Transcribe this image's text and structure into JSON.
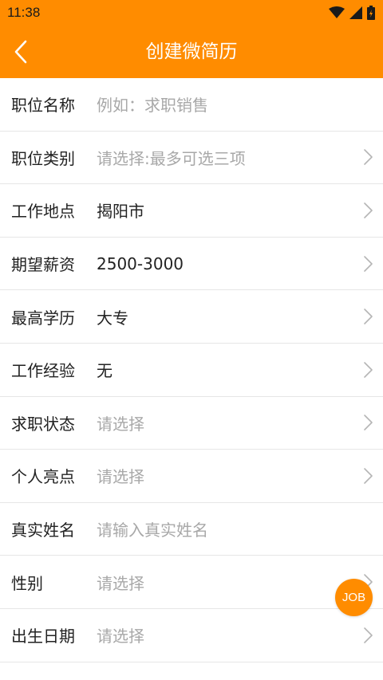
{
  "status_bar": {
    "time": "11:38",
    "icons": [
      "wifi-icon",
      "cell-signal-icon",
      "battery-icon"
    ]
  },
  "header": {
    "back_icon": "chevron-left-icon",
    "title": "创建微简历",
    "background": "#ff8c00"
  },
  "form": {
    "rows": [
      {
        "label": "职位名称",
        "value": "例如：求职销售",
        "is_placeholder": true,
        "has_chevron": false
      },
      {
        "label": "职位类别",
        "value": "请选择:最多可选三项",
        "is_placeholder": true,
        "has_chevron": true
      },
      {
        "label": "工作地点",
        "value": "揭阳市",
        "is_placeholder": false,
        "has_chevron": true
      },
      {
        "label": "期望薪资",
        "value": "2500-3000",
        "is_placeholder": false,
        "has_chevron": true
      },
      {
        "label": "最高学历",
        "value": "大专",
        "is_placeholder": false,
        "has_chevron": true
      },
      {
        "label": "工作经验",
        "value": "无",
        "is_placeholder": false,
        "has_chevron": true
      },
      {
        "label": "求职状态",
        "value": "请选择",
        "is_placeholder": true,
        "has_chevron": true
      },
      {
        "label": "个人亮点",
        "value": "请选择",
        "is_placeholder": true,
        "has_chevron": true
      },
      {
        "label": "真实姓名",
        "value": "请输入真实姓名",
        "is_placeholder": true,
        "has_chevron": false
      },
      {
        "label": "性别",
        "value": "请选择",
        "is_placeholder": true,
        "has_chevron": true
      },
      {
        "label": "出生日期",
        "value": "请选择",
        "is_placeholder": true,
        "has_chevron": true
      }
    ]
  },
  "fab": {
    "label": "JOB",
    "color": "#ff8c00"
  }
}
